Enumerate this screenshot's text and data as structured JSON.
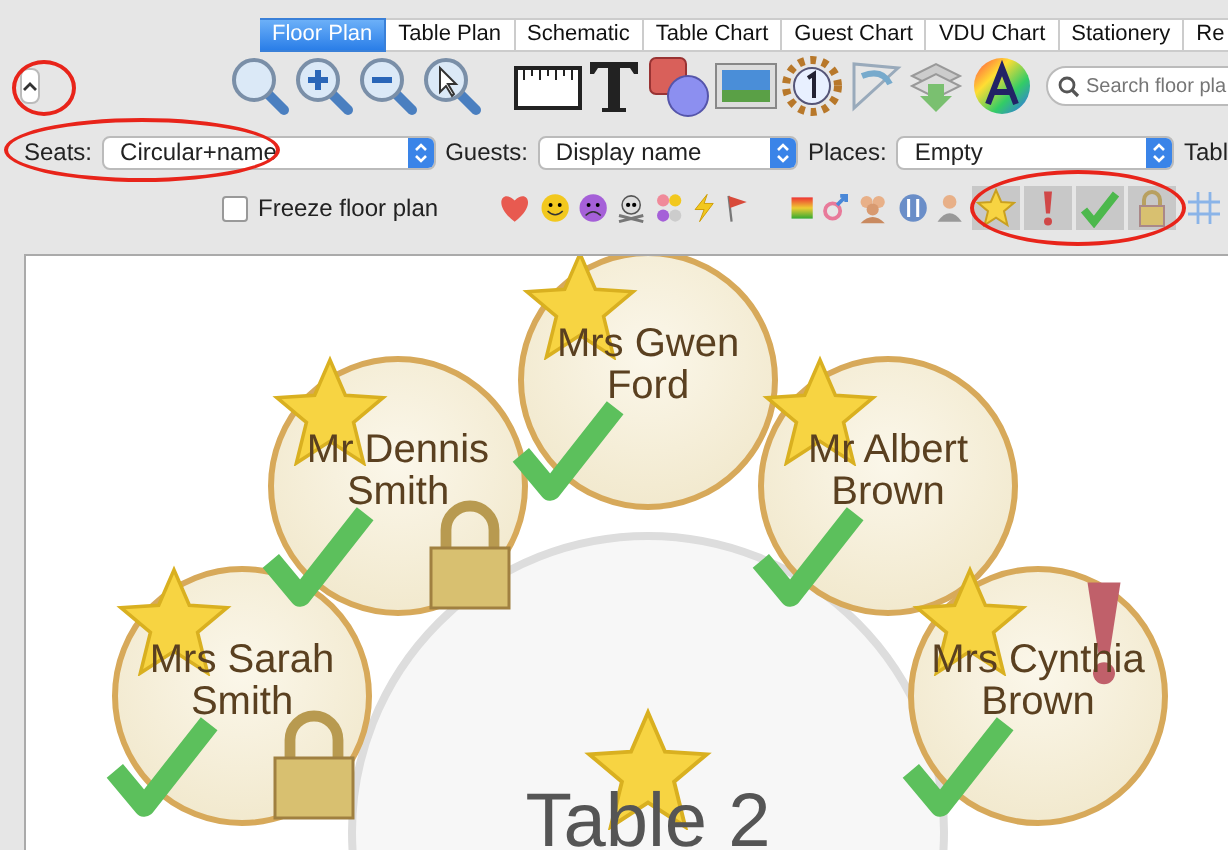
{
  "tabs": [
    {
      "label": "Floor Plan",
      "selected": true
    },
    {
      "label": "Table Plan",
      "selected": false
    },
    {
      "label": "Schematic",
      "selected": false
    },
    {
      "label": "Table Chart",
      "selected": false
    },
    {
      "label": "Guest Chart",
      "selected": false
    },
    {
      "label": "VDU Chart",
      "selected": false
    },
    {
      "label": "Stationery",
      "selected": false
    },
    {
      "label": "Re",
      "selected": false
    }
  ],
  "search": {
    "placeholder": "Search floor pla"
  },
  "options": [
    {
      "label": "Seats:",
      "value": "Circular+name"
    },
    {
      "label": "Guests:",
      "value": "Display name"
    },
    {
      "label": "Places:",
      "value": "Empty"
    }
  ],
  "options_cut_label": "Tabl",
  "freeze": {
    "label": "Freeze floor plan",
    "checked": false
  },
  "toggles": [
    {
      "kind": "star",
      "on": true
    },
    {
      "kind": "alert",
      "on": true
    },
    {
      "kind": "check",
      "on": true
    },
    {
      "kind": "lock",
      "on": true
    },
    {
      "kind": "grid",
      "on": false
    }
  ],
  "table": {
    "name": "Table 2",
    "star": true
  },
  "seats": [
    {
      "name": "Mrs Sarah Smith",
      "star": true,
      "check": true,
      "lock": true,
      "alert": false
    },
    {
      "name": "Mr Dennis Smith",
      "star": true,
      "check": true,
      "lock": true,
      "alert": false
    },
    {
      "name": "Mrs Gwen Ford",
      "star": true,
      "check": true,
      "lock": false,
      "alert": false
    },
    {
      "name": "Mr Albert Brown",
      "star": true,
      "check": true,
      "lock": false,
      "alert": false
    },
    {
      "name": "Mrs Cynthia Brown",
      "star": true,
      "check": true,
      "lock": false,
      "alert": true
    }
  ]
}
